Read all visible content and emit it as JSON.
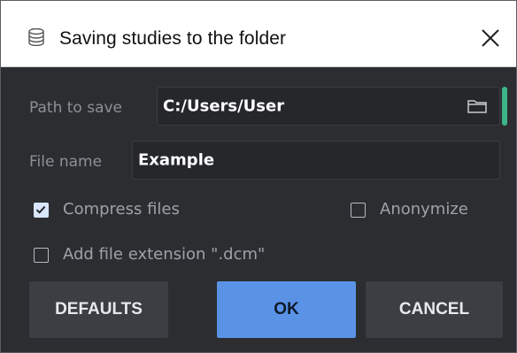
{
  "window": {
    "title": "Saving studies to the folder",
    "title_icon": "database-icon",
    "close_icon": "close-icon"
  },
  "form": {
    "path_label": "Path to save",
    "path_value": "C:/Users/User",
    "folder_icon": "folder-icon",
    "file_name_label": "File name",
    "file_name_value": "Example"
  },
  "options": {
    "compress": {
      "label": "Compress files",
      "checked": true
    },
    "anonymize": {
      "label": "Anonymize",
      "checked": false
    },
    "add_extension": {
      "label": "Add file extension \".dcm\"",
      "checked": false
    }
  },
  "buttons": {
    "defaults": "DEFAULTS",
    "ok": "OK",
    "cancel": "CANCEL"
  },
  "colors": {
    "background": "#2b2d30",
    "primary_button": "#5a93e6",
    "secondary_button": "#3b3e42",
    "accent": "#3eb489"
  }
}
